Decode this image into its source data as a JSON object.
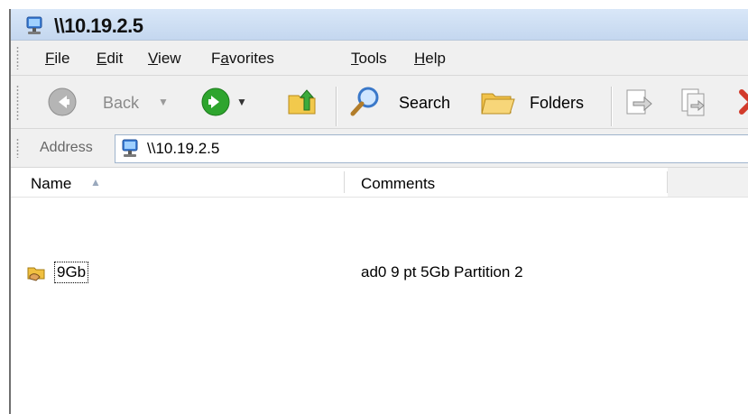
{
  "window": {
    "title": "\\\\10.19.2.5"
  },
  "menu": {
    "items": [
      {
        "label": "File",
        "accel": "F",
        "rest": "ile"
      },
      {
        "label": "Edit",
        "accel": "E",
        "rest": "dit"
      },
      {
        "label": "View",
        "accel": "V",
        "rest": "iew"
      },
      {
        "label": "Favorites",
        "pre": "F",
        "accel": "a",
        "rest": "vorites"
      },
      {
        "label": "Tools",
        "accel": "T",
        "rest": "ools"
      },
      {
        "label": "Help",
        "accel": "H",
        "rest": "elp"
      }
    ]
  },
  "toolbar": {
    "back_label": "Back",
    "search_label": "Search",
    "folders_label": "Folders"
  },
  "address": {
    "label": "Address",
    "value": "\\\\10.19.2.5"
  },
  "columns": {
    "name": "Name",
    "comments": "Comments"
  },
  "rows": [
    {
      "name": "9Gb",
      "comment": "ad0 9 pt 5Gb Partition 2"
    }
  ],
  "icons": {
    "title": "network-computer-icon",
    "back": "back-arrow-icon",
    "forward": "forward-arrow-icon",
    "up": "up-folder-icon",
    "search": "search-icon",
    "folders": "folders-icon",
    "move_to": "move-to-icon",
    "copy_to": "copy-to-icon",
    "delete": "delete-icon",
    "share": "shared-folder-icon"
  },
  "colors": {
    "forward_green": "#2ea52e",
    "back_gray": "#a8a8a8",
    "delete_red": "#d23b2b"
  }
}
